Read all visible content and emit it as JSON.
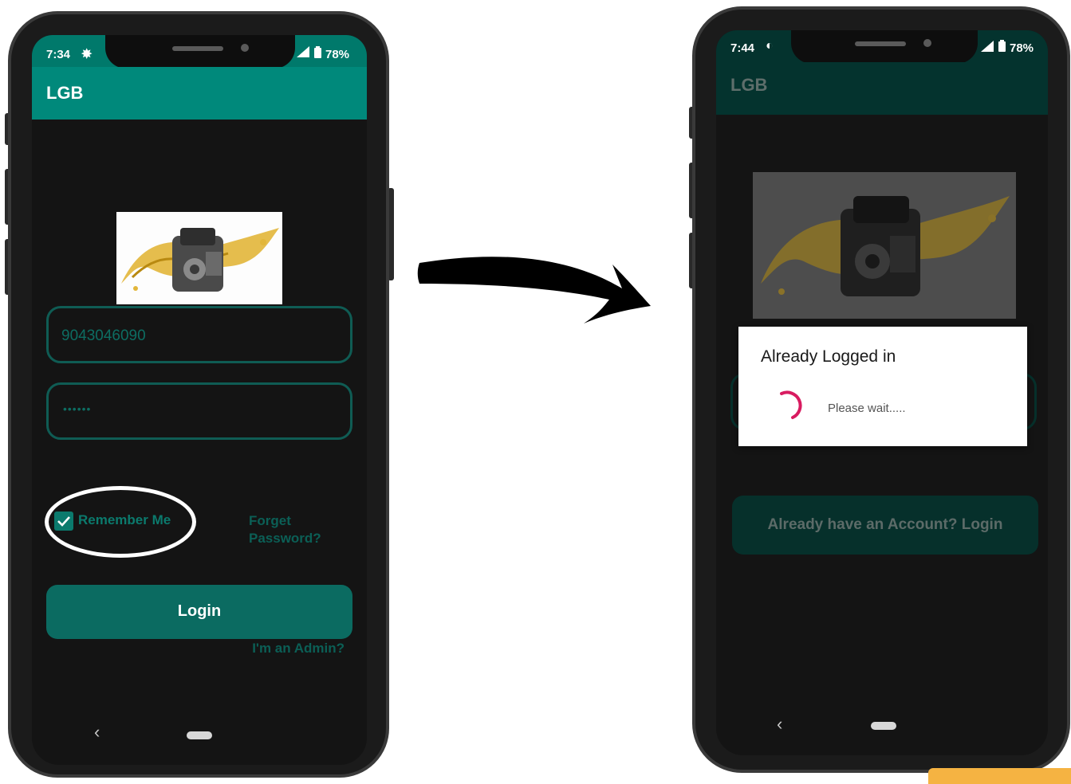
{
  "left_phone": {
    "status": {
      "time": "7:34",
      "battery": "78%"
    },
    "appbar": {
      "title": "LGB"
    },
    "login_form": {
      "phone_value": "9043046090",
      "password_value": "••••••",
      "remember_me": {
        "label": "Remember Me",
        "checked": true
      },
      "forgot_password": "Forget\nPassword?",
      "login_button": "Login",
      "admin_link": "I'm an Admin?"
    },
    "navbar": {
      "back": "‹"
    }
  },
  "right_phone": {
    "status": {
      "time": "7:44",
      "battery": "78%"
    },
    "appbar": {
      "title": "LGB"
    },
    "dialog": {
      "title": "Already Logged in",
      "message": "Please wait....."
    },
    "account_button": "Already have an Account? Login",
    "navbar": {
      "back": "‹"
    }
  },
  "colors": {
    "teal_primary": "#00897b",
    "teal_dark": "#0b6b61",
    "teal_dimmed": "#04352f",
    "spinner": "#d81b60",
    "background": "#141414"
  }
}
